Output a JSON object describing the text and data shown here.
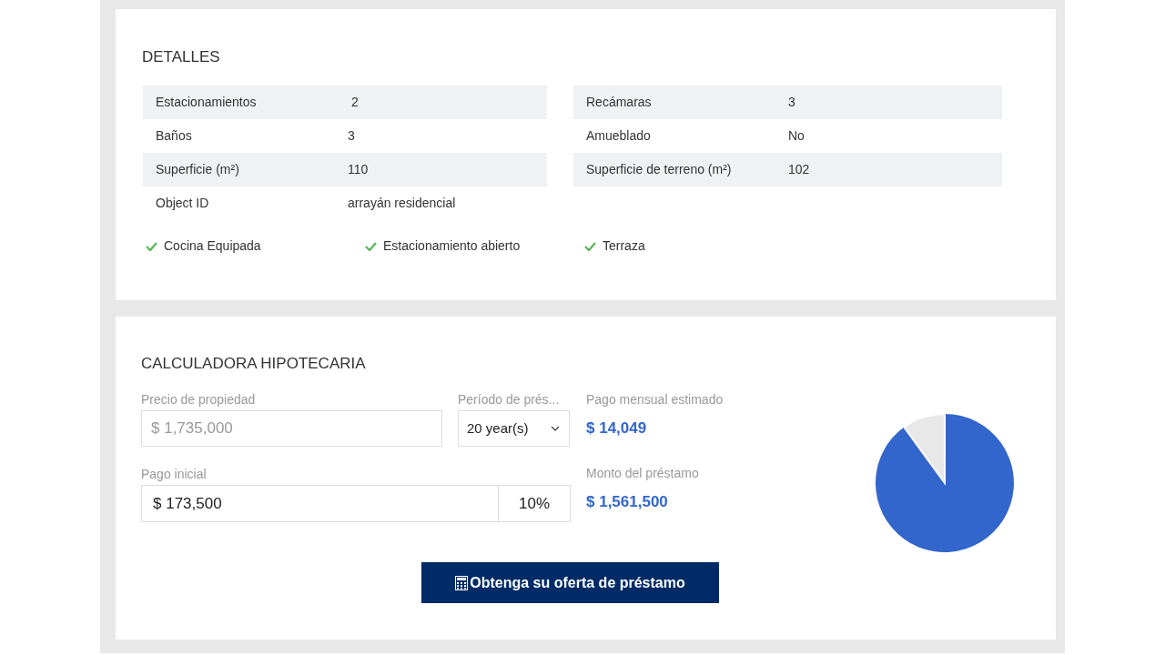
{
  "details": {
    "title": "DETALLES",
    "left": [
      {
        "label": "Estacionamientos",
        "value": " 2"
      },
      {
        "label": "Baños",
        "value": "3"
      },
      {
        "label": "Superficie (m²)",
        "value": "110"
      },
      {
        "label": "Object ID",
        "value": "arrayán residencial"
      }
    ],
    "right": [
      {
        "label": "Recámaras",
        "value": "3"
      },
      {
        "label": "Amueblado",
        "value": "No"
      },
      {
        "label": "Superficie de terreno (m²)",
        "value": "102"
      }
    ],
    "features": [
      "Cocina Equipada",
      "Estacionamiento abierto",
      "Terraza"
    ]
  },
  "calculator": {
    "title": "CALCULADORA HIPOTECARIA",
    "price": {
      "label": "Precio de propiedad",
      "value": "$ 1,735,000",
      "disabled": true
    },
    "period": {
      "label": "Período de prés...",
      "value": "20 year(s)"
    },
    "down_payment": {
      "label": "Pago inicial",
      "value": "$ 173,500",
      "percent": "10%",
      "disabled": false
    },
    "monthly": {
      "label": "Pago mensual estimado",
      "value": "$ 14,049"
    },
    "loan": {
      "label": "Monto del préstamo",
      "value": "$ 1,561,500"
    },
    "button": "Obtenga su oferta de préstamo"
  }
}
